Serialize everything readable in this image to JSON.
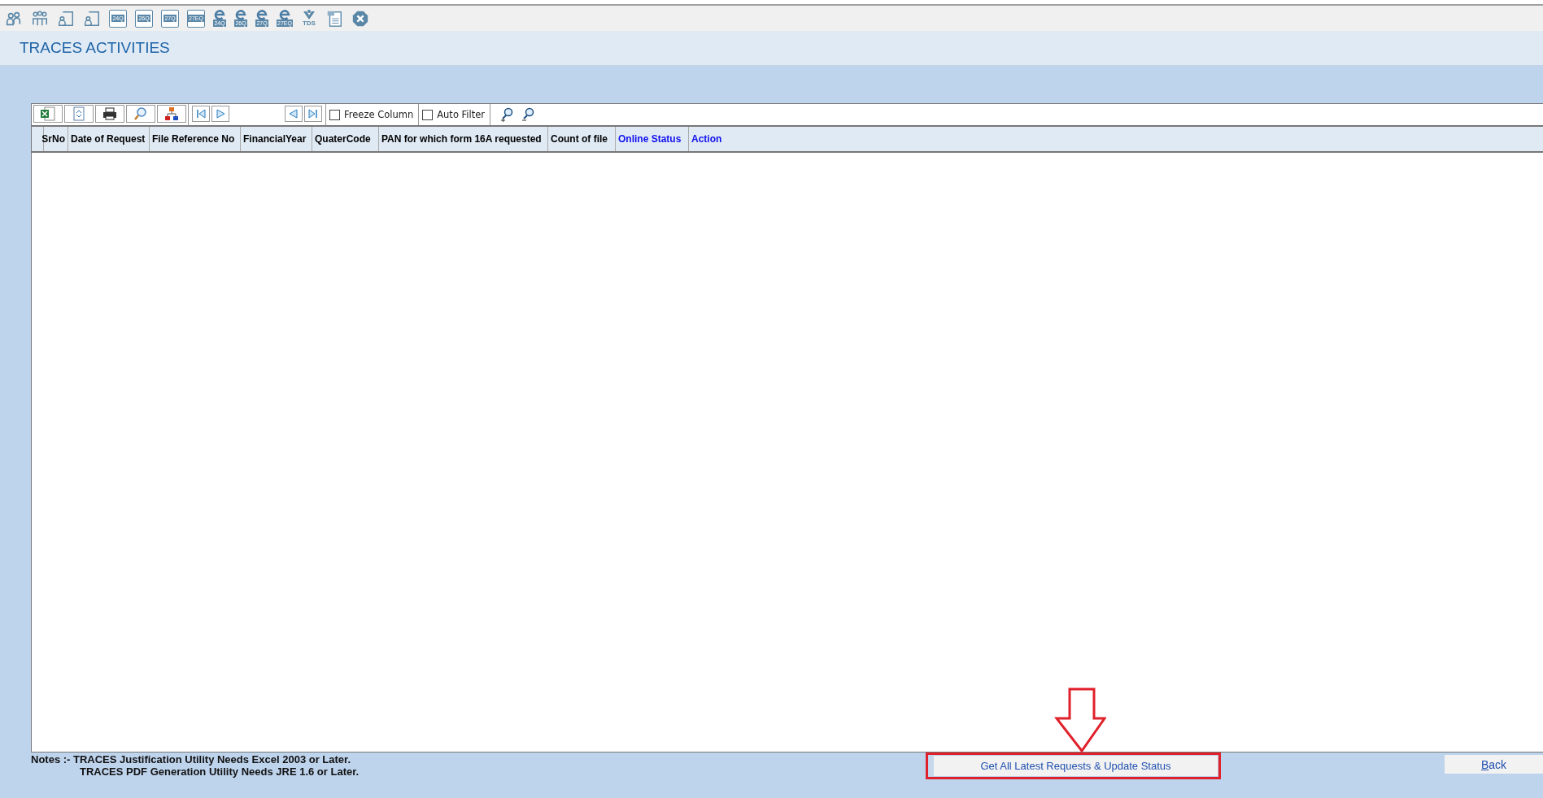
{
  "app_toolbar": [
    {
      "kind": "person"
    },
    {
      "kind": "group"
    },
    {
      "kind": "person-form"
    },
    {
      "kind": "person-form"
    },
    {
      "kind": "form",
      "label": "24Q"
    },
    {
      "kind": "form",
      "label": "26Q"
    },
    {
      "kind": "form",
      "label": "27Q"
    },
    {
      "kind": "form",
      "label": "27EQ"
    },
    {
      "kind": "eform",
      "label": "24Q"
    },
    {
      "kind": "eform",
      "label": "26Q"
    },
    {
      "kind": "eform",
      "label": "27Q"
    },
    {
      "kind": "eform",
      "label": "27EQ"
    },
    {
      "kind": "tds",
      "label": "TDS"
    },
    {
      "kind": "pdf"
    },
    {
      "kind": "close"
    }
  ],
  "page_title": "TRACES ACTIVITIES",
  "grid_toolbar": {
    "buttons": [
      {
        "kind": "excel"
      },
      {
        "kind": "export"
      },
      {
        "kind": "print"
      },
      {
        "kind": "find"
      },
      {
        "kind": "tree"
      }
    ],
    "nav_left": [
      {
        "kind": "first"
      },
      {
        "kind": "next"
      }
    ],
    "nav_right": [
      {
        "kind": "prev"
      },
      {
        "kind": "last"
      }
    ],
    "options": [
      {
        "label": "Freeze Column",
        "checked": false
      },
      {
        "label": "Auto Filter",
        "checked": false
      }
    ],
    "zoom": [
      {
        "kind": "zoom-in"
      },
      {
        "kind": "zoom-out"
      }
    ]
  },
  "table": {
    "columns": [
      {
        "label": "SrNo",
        "kind": "plain"
      },
      {
        "label": "Date of Request",
        "kind": "plain"
      },
      {
        "label": "File Reference No",
        "kind": "plain"
      },
      {
        "label": "FinancialYear",
        "kind": "plain"
      },
      {
        "label": "QuaterCode",
        "kind": "plain"
      },
      {
        "label": "PAN for which form 16A requested",
        "kind": "plain"
      },
      {
        "label": "Count of file",
        "kind": "plain"
      },
      {
        "label": "Online Status",
        "kind": "link"
      },
      {
        "label": "Action",
        "kind": "link"
      }
    ]
  },
  "notes": {
    "label": "Notes :-",
    "lines": [
      "TRACES Justification Utility Needs Excel 2003 or Later.",
      "TRACES PDF Generation Utility Needs JRE 1.6 or Later."
    ]
  },
  "update_button": {
    "label": "Get All Latest Requests & Update Status",
    "highlighted": true
  },
  "back_button": {
    "label": "Back"
  }
}
